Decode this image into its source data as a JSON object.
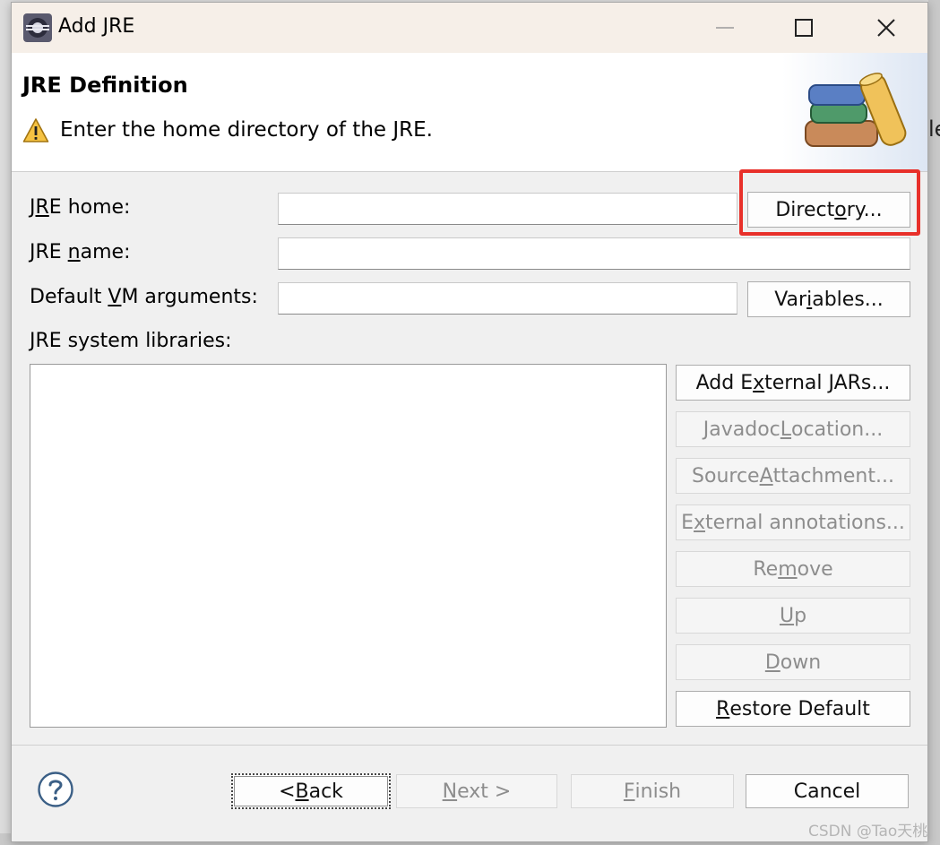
{
  "window": {
    "title": "Add JRE"
  },
  "header": {
    "title": "JRE Definition",
    "message": "Enter the home directory of the JRE."
  },
  "form": {
    "jre_home": {
      "label_pre": "J",
      "label_acc": "R",
      "label_post": "E home:",
      "value": ""
    },
    "jre_name": {
      "label_pre": "JRE ",
      "label_acc": "n",
      "label_post": "ame:",
      "value": ""
    },
    "vm_args": {
      "label_pre": "Default ",
      "label_acc": "V",
      "label_post": "M arguments:",
      "value": ""
    },
    "libraries_label": "JRE system libraries:"
  },
  "buttons": {
    "directory": {
      "pre": "Direct",
      "acc": "o",
      "post": "ry...",
      "enabled": true
    },
    "variables": {
      "pre": "Var",
      "acc": "i",
      "post": "ables...",
      "enabled": true
    },
    "add_external_jars": {
      "pre": "Add E",
      "acc": "x",
      "post": "ternal JARs...",
      "enabled": true
    },
    "javadoc_location": {
      "pre": "Javadoc ",
      "acc": "L",
      "post": "ocation...",
      "enabled": false
    },
    "source_attachment": {
      "pre": "Source ",
      "acc": "A",
      "post": "ttachment...",
      "enabled": false
    },
    "external_annotations": {
      "pre": "E",
      "acc": "x",
      "post": "ternal annotations...",
      "enabled": false
    },
    "remove": {
      "pre": "Re",
      "acc": "m",
      "post": "ove",
      "enabled": false
    },
    "up": {
      "pre": "",
      "acc": "U",
      "post": "p",
      "enabled": false
    },
    "down": {
      "pre": "",
      "acc": "D",
      "post": "own",
      "enabled": false
    },
    "restore_default": {
      "pre": "",
      "acc": "R",
      "post": "estore Default",
      "enabled": true
    }
  },
  "footer": {
    "back": {
      "pre": "< ",
      "acc": "B",
      "post": "ack",
      "enabled": true
    },
    "next": {
      "pre": "",
      "acc": "N",
      "post": "ext >",
      "enabled": false
    },
    "finish": {
      "pre": "",
      "acc": "F",
      "post": "inish",
      "enabled": false
    },
    "cancel": {
      "label": "Cancel",
      "enabled": true
    }
  },
  "background": {
    "edge_text": "le"
  },
  "watermark": "CSDN @Tao天桃",
  "colors": {
    "highlight": "#e8302a",
    "disabled_text": "#8d8d8d"
  },
  "icons": [
    "eclipse-app-icon",
    "minimize-icon",
    "maximize-icon",
    "close-icon",
    "warning-icon",
    "books-icon",
    "help-icon"
  ]
}
